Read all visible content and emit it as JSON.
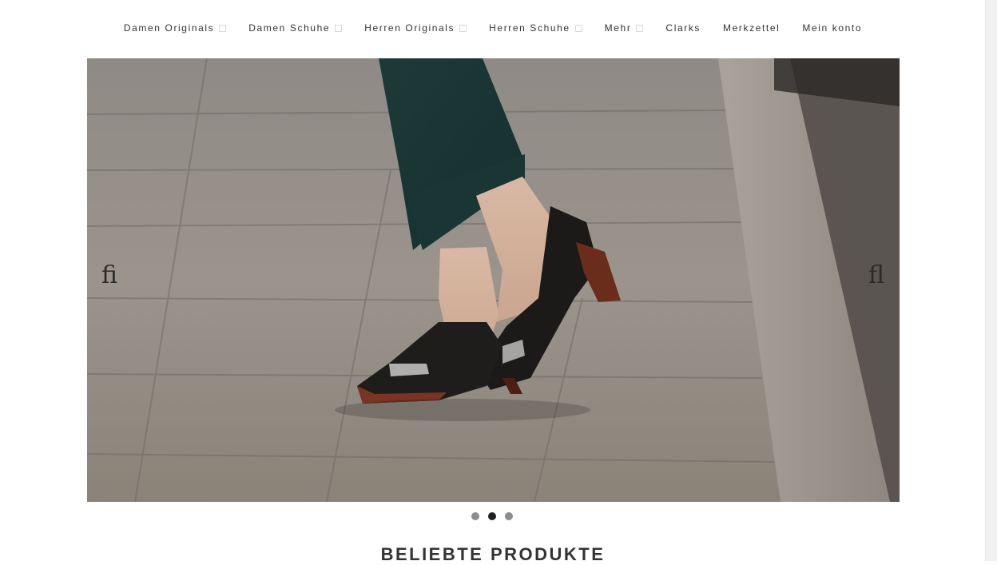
{
  "nav": {
    "items": [
      {
        "label": "Damen Originals",
        "has_dropdown": true
      },
      {
        "label": "Damen Schuhe",
        "has_dropdown": true
      },
      {
        "label": "Herren Originals",
        "has_dropdown": true
      },
      {
        "label": "Herren Schuhe",
        "has_dropdown": true
      },
      {
        "label": "Mehr",
        "has_dropdown": true
      },
      {
        "label": "Clarks",
        "has_dropdown": false
      },
      {
        "label": "Merkzettel",
        "has_dropdown": false
      },
      {
        "label": "Mein konto",
        "has_dropdown": false
      }
    ]
  },
  "slider": {
    "prev_glyph": "ﬁ",
    "next_glyph": "ﬂ",
    "slide_count": 3,
    "active_index": 1,
    "image_description_icon": "hero-shoe-image"
  },
  "section": {
    "title": "BELIEBTE PRODUKTE"
  },
  "colors": {
    "text": "#333333",
    "dot_inactive": "#8d8d8d",
    "dot_active": "#222222"
  }
}
